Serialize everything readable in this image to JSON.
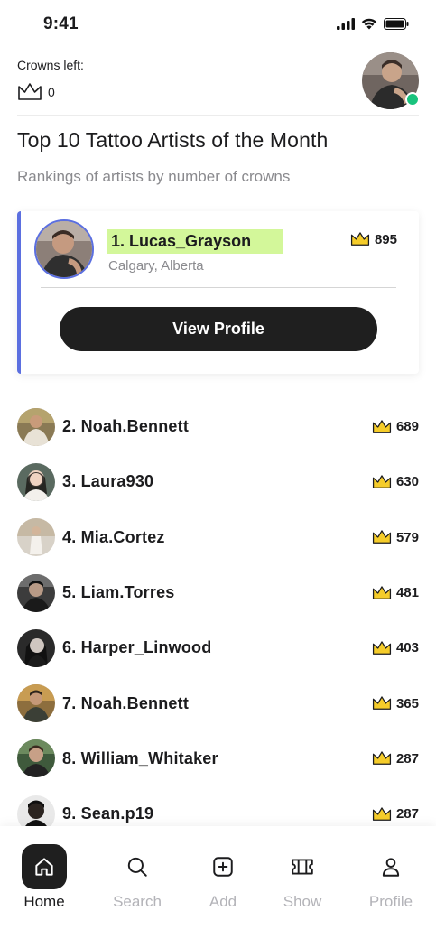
{
  "status": {
    "time": "9:41"
  },
  "header": {
    "crowns_label": "Crowns left:",
    "crowns_count": "0"
  },
  "page": {
    "title": "Top 10 Tattoo Artists of the Month",
    "subtitle": "Rankings of artists by number of crowns"
  },
  "top_artist": {
    "name": "1. Lucas_Grayson",
    "location": "Calgary, Alberta",
    "crowns": "895",
    "button_label": "View Profile"
  },
  "rankings": [
    {
      "name": "2. Noah.Bennett",
      "crowns": "689"
    },
    {
      "name": "3. Laura930",
      "crowns": "630"
    },
    {
      "name": "4. Mia.Cortez",
      "crowns": "579"
    },
    {
      "name": "5. Liam.Torres",
      "crowns": "481"
    },
    {
      "name": "6. Harper_Linwood",
      "crowns": "403"
    },
    {
      "name": "7. Noah.Bennett",
      "crowns": "365"
    },
    {
      "name": "8. William_Whitaker",
      "crowns": "287"
    },
    {
      "name": "9. Sean.p19",
      "crowns": "287"
    }
  ],
  "nav": [
    {
      "label": "Home",
      "icon": "home-icon",
      "active": true
    },
    {
      "label": "Search",
      "icon": "search-icon",
      "active": false
    },
    {
      "label": "Add",
      "icon": "add-icon",
      "active": false
    },
    {
      "label": "Show",
      "icon": "ticket-icon",
      "active": false
    },
    {
      "label": "Profile",
      "icon": "person-icon",
      "active": false
    }
  ],
  "colors": {
    "accent": "#5b6fe0",
    "highlight": "#d3f79a",
    "crown": "#f5cc2a",
    "online": "#19c37d",
    "button": "#1f1f1f"
  }
}
